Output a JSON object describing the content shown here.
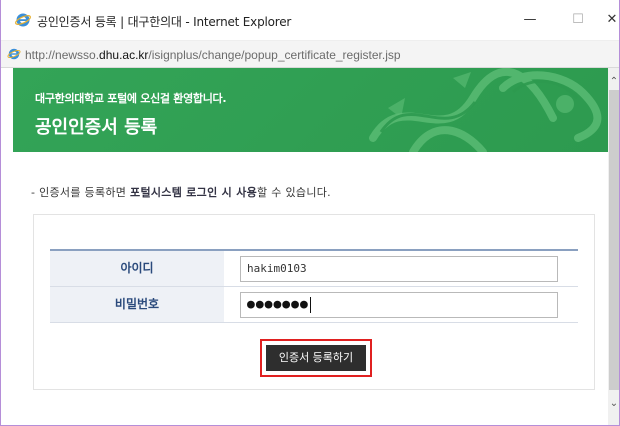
{
  "window": {
    "title": "공인인증서 등록 | 대구한의대 - Internet Explorer",
    "controls": {
      "minimize": "—",
      "maximize": "☐",
      "close": "✕"
    }
  },
  "address": {
    "prefix": "http://newsso.",
    "domain": "dhu.ac.kr",
    "path": "/isignplus/change/popup_certificate_register.jsp"
  },
  "banner": {
    "subtitle": "대구한의대학교 포털에 오신걸 환영합니다.",
    "title": "공인인증서 등록"
  },
  "notice": {
    "prefix": "- 인증서를 등록하면 ",
    "emphasis": "포털시스템 로그인 시 사용",
    "suffix": "할 수 있습니다."
  },
  "form": {
    "id_label": "아이디",
    "id_value": "hakim0103",
    "password_label": "비밀번호",
    "password_mask": "●●●●●●●"
  },
  "submit_label": "인증서 등록하기",
  "colors": {
    "banner_green": "#2d9a4f",
    "label_text": "#2a4a7c",
    "highlight": "#e02020",
    "button_bg": "#2e2e2e"
  },
  "icons": [
    "ie-logo-icon",
    "page-ie-icon",
    "dragon-decoration",
    "scroll-up-icon",
    "scroll-down-icon"
  ]
}
